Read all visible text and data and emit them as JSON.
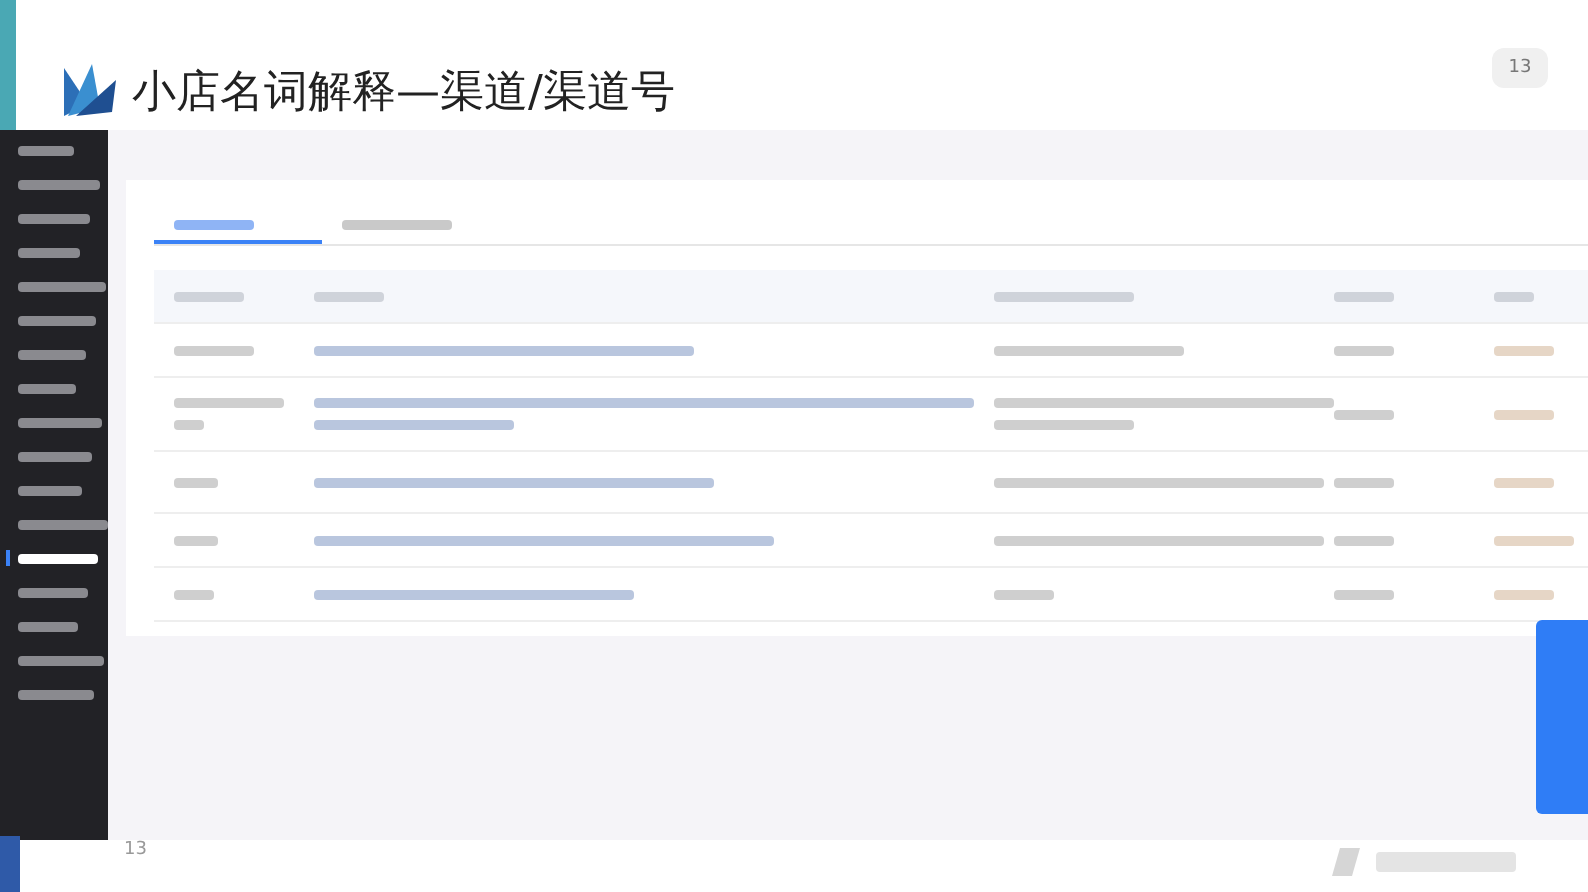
{
  "slide": {
    "title": "小店名词解释—渠道/渠道号",
    "page_number": "13"
  },
  "embedded_screenshot": {
    "sidebar": {
      "items": [
        {
          "selected": false
        },
        {
          "selected": false
        },
        {
          "selected": false
        },
        {
          "selected": false
        },
        {
          "selected": false
        },
        {
          "selected": false
        },
        {
          "selected": false
        },
        {
          "selected": false
        },
        {
          "selected": false
        },
        {
          "selected": false
        },
        {
          "selected": false
        },
        {
          "selected": false
        },
        {
          "selected": true
        },
        {
          "selected": false
        },
        {
          "selected": false
        },
        {
          "selected": false
        },
        {
          "selected": false
        }
      ]
    },
    "tabs": [
      {
        "selected": true
      },
      {
        "selected": false
      }
    ],
    "footer_page_number": "13"
  }
}
